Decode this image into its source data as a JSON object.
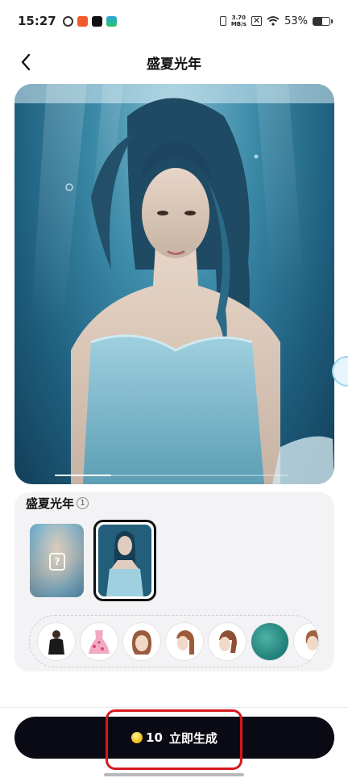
{
  "status_bar": {
    "time": "15:27",
    "app_icons": [
      "swirl-app-icon",
      "shop-app-icon",
      "tiktok-app-icon",
      "map-app-icon"
    ],
    "net_speed_value": "3.70",
    "net_speed_unit": "MB/s",
    "battery_percent": "53%",
    "battery_level": 0.53
  },
  "header": {
    "title": "盛夏光年",
    "back_icon": "chevron-left-icon"
  },
  "hero": {
    "image": "underwater-portrait-woman-blue-dress",
    "page_index": 1
  },
  "panel": {
    "title": "盛夏光年",
    "badge": "1",
    "lock_symbol": "?",
    "thumbnails": [
      {
        "name": "locked-style-thumb",
        "state": "locked"
      },
      {
        "name": "selected-style-thumb",
        "state": "selected"
      }
    ],
    "accessories": [
      "black-jacket",
      "pink-dress",
      "hairstyle-1",
      "hairstyle-2",
      "hairstyle-3",
      "teal-fabric",
      "hairstyle-4"
    ]
  },
  "footer": {
    "cost": "10",
    "action_label": "立即生成",
    "coin_icon": "coin-icon"
  },
  "colors": {
    "accent": "#0a0a14",
    "annotation": "#d7191e",
    "water": "#1f5f7f"
  }
}
